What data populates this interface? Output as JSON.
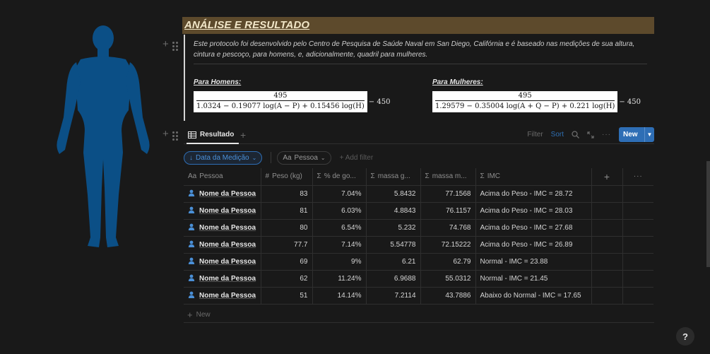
{
  "heading": "ANÁLISE E RESULTADO",
  "protocol_text": "Este protocolo foi desenvolvido pelo Centro de Pesquisa de Saúde Naval em San Diego, Califórnia e é baseado nas medições de sua altura, cintura e pescoço, para homens, e, adicionalmente, quadril para mulheres.",
  "men": {
    "label": "Para Homens:",
    "numerator": "495",
    "denominator": "1.0324 − 0.19077 log(A − P) + 0.15456 log(H)",
    "tail": "− 450"
  },
  "women": {
    "label": "Para Mulheres:",
    "numerator": "495",
    "denominator": "1.29579 − 0.35004 log(A + Q − P) + 0.221 log(H)",
    "tail": "− 450"
  },
  "database": {
    "view_name": "Resultado",
    "filter_label": "Filter",
    "sort_label": "Sort",
    "new_button": "New",
    "sort_chip": "Data da Medição",
    "property_chip": "Pessoa",
    "add_filter": "Add filter",
    "new_row": "New"
  },
  "columns": [
    {
      "icon": "Aa",
      "label": "Pessoa"
    },
    {
      "icon": "#",
      "label": "Peso (kg)"
    },
    {
      "icon": "Σ",
      "label": "% de go..."
    },
    {
      "icon": "Σ",
      "label": "massa g..."
    },
    {
      "icon": "Σ",
      "label": "massa m..."
    },
    {
      "icon": "Σ",
      "label": "IMC"
    }
  ],
  "rows": [
    {
      "pessoa": "Nome da Pessoa",
      "peso": "83",
      "gordura": "7.04%",
      "massa_g": "5.8432",
      "massa_m": "77.1568",
      "imc": "Acima do Peso - IMC = 28.72"
    },
    {
      "pessoa": "Nome da Pessoa",
      "peso": "81",
      "gordura": "6.03%",
      "massa_g": "4.8843",
      "massa_m": "76.1157",
      "imc": "Acima do Peso - IMC = 28.03"
    },
    {
      "pessoa": "Nome da Pessoa",
      "peso": "80",
      "gordura": "6.54%",
      "massa_g": "5.232",
      "massa_m": "74.768",
      "imc": "Acima do Peso - IMC = 27.68"
    },
    {
      "pessoa": "Nome da Pessoa",
      "peso": "77.7",
      "gordura": "7.14%",
      "massa_g": "5.54778",
      "massa_m": "72.15222",
      "imc": "Acima do Peso - IMC = 26.89"
    },
    {
      "pessoa": "Nome da Pessoa",
      "peso": "69",
      "gordura": "9%",
      "massa_g": "6.21",
      "massa_m": "62.79",
      "imc": "Normal - IMC = 23.88"
    },
    {
      "pessoa": "Nome da Pessoa",
      "peso": "62",
      "gordura": "11.24%",
      "massa_g": "6.9688",
      "massa_m": "55.0312",
      "imc": "Normal - IMC = 21.45"
    },
    {
      "pessoa": "Nome da Pessoa",
      "peso": "51",
      "gordura": "14.14%",
      "massa_g": "7.2114",
      "massa_m": "43.7886",
      "imc": "Abaixo do Normal - IMC = 17.65"
    }
  ],
  "help": "?",
  "colors": {
    "accent": "#2e6eb5",
    "heading_bg": "#5d4a2c",
    "silhouette": "#0b4f86"
  }
}
